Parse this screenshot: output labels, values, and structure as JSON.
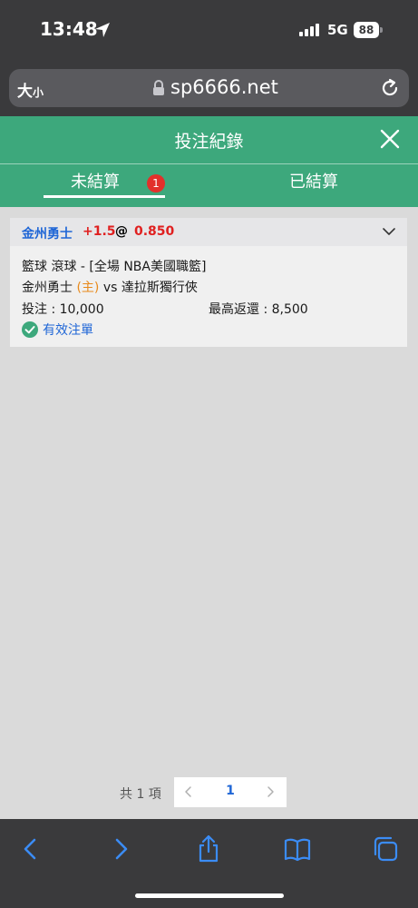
{
  "status_bar": {
    "time": "13:48",
    "network": "5G",
    "battery": "88"
  },
  "browser": {
    "text_size_label": "大",
    "text_size_small": "小",
    "url": "sp6666.net"
  },
  "header": {
    "title": "投注紀錄"
  },
  "tabs": [
    {
      "label": "未結算",
      "badge": "1",
      "active": true
    },
    {
      "label": "已結算",
      "active": false
    }
  ],
  "bet": {
    "team": "金州勇士",
    "handicap": "+1.5",
    "at": "@",
    "odds": "0.850",
    "sport_market": "籃球 滾球 - [全場 NBA美國職籃]",
    "home_team": "金州勇士",
    "home_tag": "(主)",
    "vs_label": "vs",
    "away_team": "達拉斯獨行俠",
    "stake": "投注 : 10,000",
    "max_return": "最高返還 : 8,500",
    "status": "有效注單"
  },
  "pagination": {
    "total": "共 1 項",
    "current_page": "1"
  },
  "colors": {
    "brand_green": "#3da87c",
    "team_blue": "#1f66d6",
    "odds_red": "#e02020",
    "badge_red": "#e2302b",
    "home_orange": "#e8891a",
    "ios_blue": "#3b8cf5"
  },
  "icons": [
    "location-arrow-icon",
    "lock-icon",
    "reload-icon",
    "close-icon",
    "chevron-down-icon",
    "check-circle-icon",
    "back-icon",
    "forward-icon",
    "share-icon",
    "bookmarks-icon",
    "tabs-icon"
  ]
}
